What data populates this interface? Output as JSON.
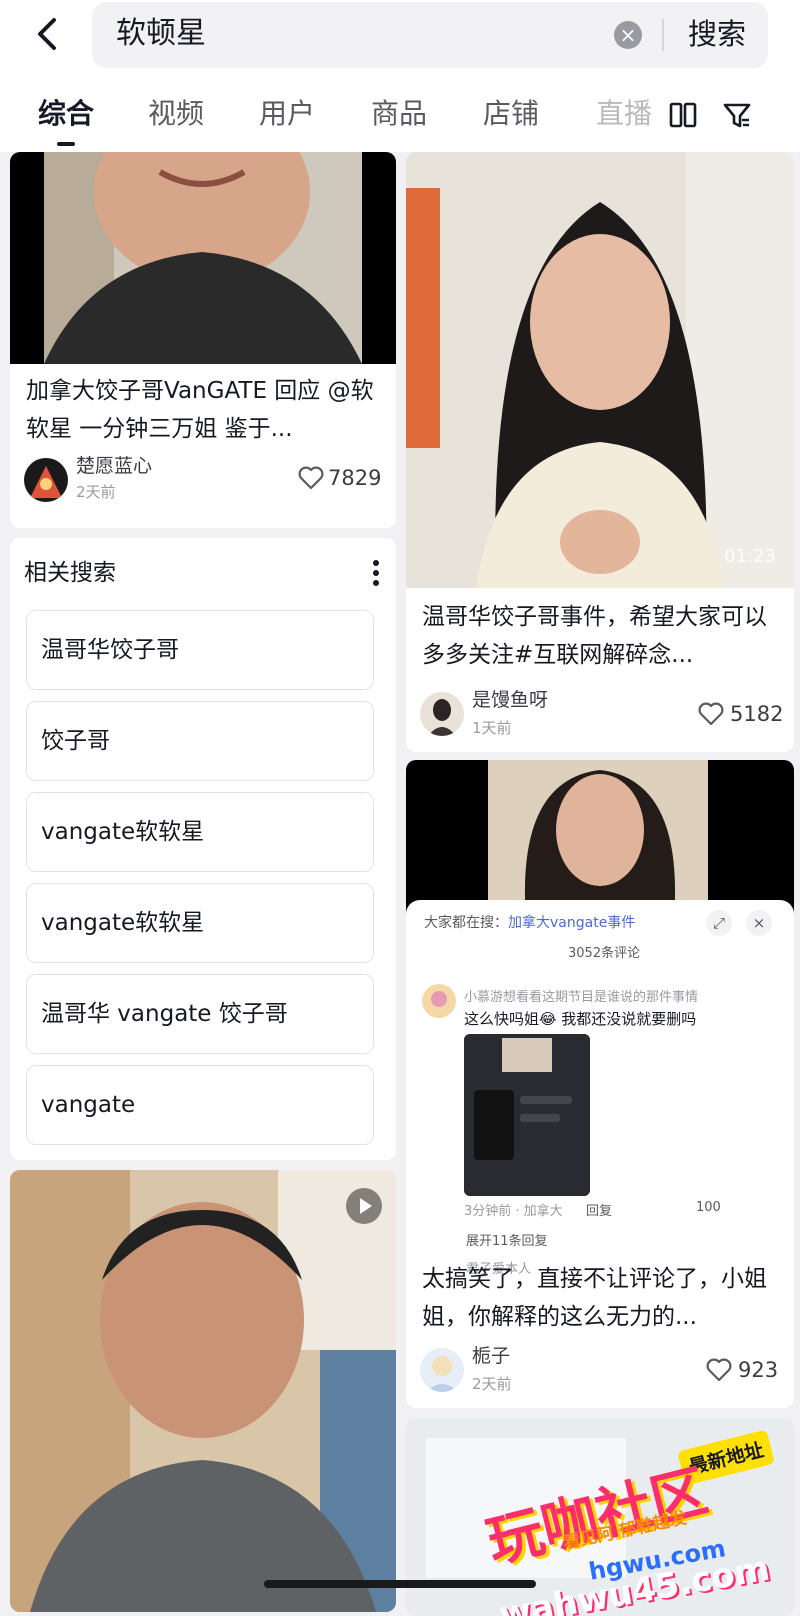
{
  "search": {
    "query": "软顿星",
    "submit_label": "搜索"
  },
  "tabs": [
    {
      "label": "综合",
      "active": true
    },
    {
      "label": "视频"
    },
    {
      "label": "用户"
    },
    {
      "label": "商品"
    },
    {
      "label": "店铺"
    },
    {
      "label": "直播"
    }
  ],
  "cards": {
    "left_top": {
      "title": "加拿大饺子哥VanGATE 回应 @软软星 一分钟三万姐 鉴于...",
      "author": "楚愿蓝心",
      "time": "2天前",
      "likes": "7829"
    },
    "right_top": {
      "title": "温哥华饺子哥事件，希望大家可以多多关注#互联网解碎念...",
      "author": "是馒鱼呀",
      "time": "1天前",
      "likes": "5182",
      "duration": "01:23"
    },
    "right_mid": {
      "title": "太搞笑了，直接不让评论了，小姐姐，你解释的这么无力的...",
      "author": "栀子",
      "time": "2天前",
      "likes": "923",
      "comments": {
        "header_prefix": "大家都在搜：",
        "header_query": "加拿大vangate事件",
        "count": "3052条评论",
        "commenter": "小慕游想看看这期节目是谁说的那件事情",
        "comment_text": "这么快吗姐😂 我都还没说就要删吗",
        "time": "3分钟前 · 加拿大",
        "reply": "回复",
        "like_count": "100",
        "expand": "展开11条回复",
        "next_commenter": "君子爱本人"
      }
    }
  },
  "related": {
    "title": "相关搜索",
    "items": [
      "温哥华饺子哥",
      "饺子哥",
      "vangate软软星",
      "vangate软软星",
      "温哥华 vangate 饺子哥",
      "vangate"
    ]
  },
  "watermark": {
    "title": "玩咖社区",
    "tag": "最新地址",
    "line": "看见阿 郁鞋越发",
    "url1": "hgwu.com",
    "url2": "wahwu45.com"
  }
}
